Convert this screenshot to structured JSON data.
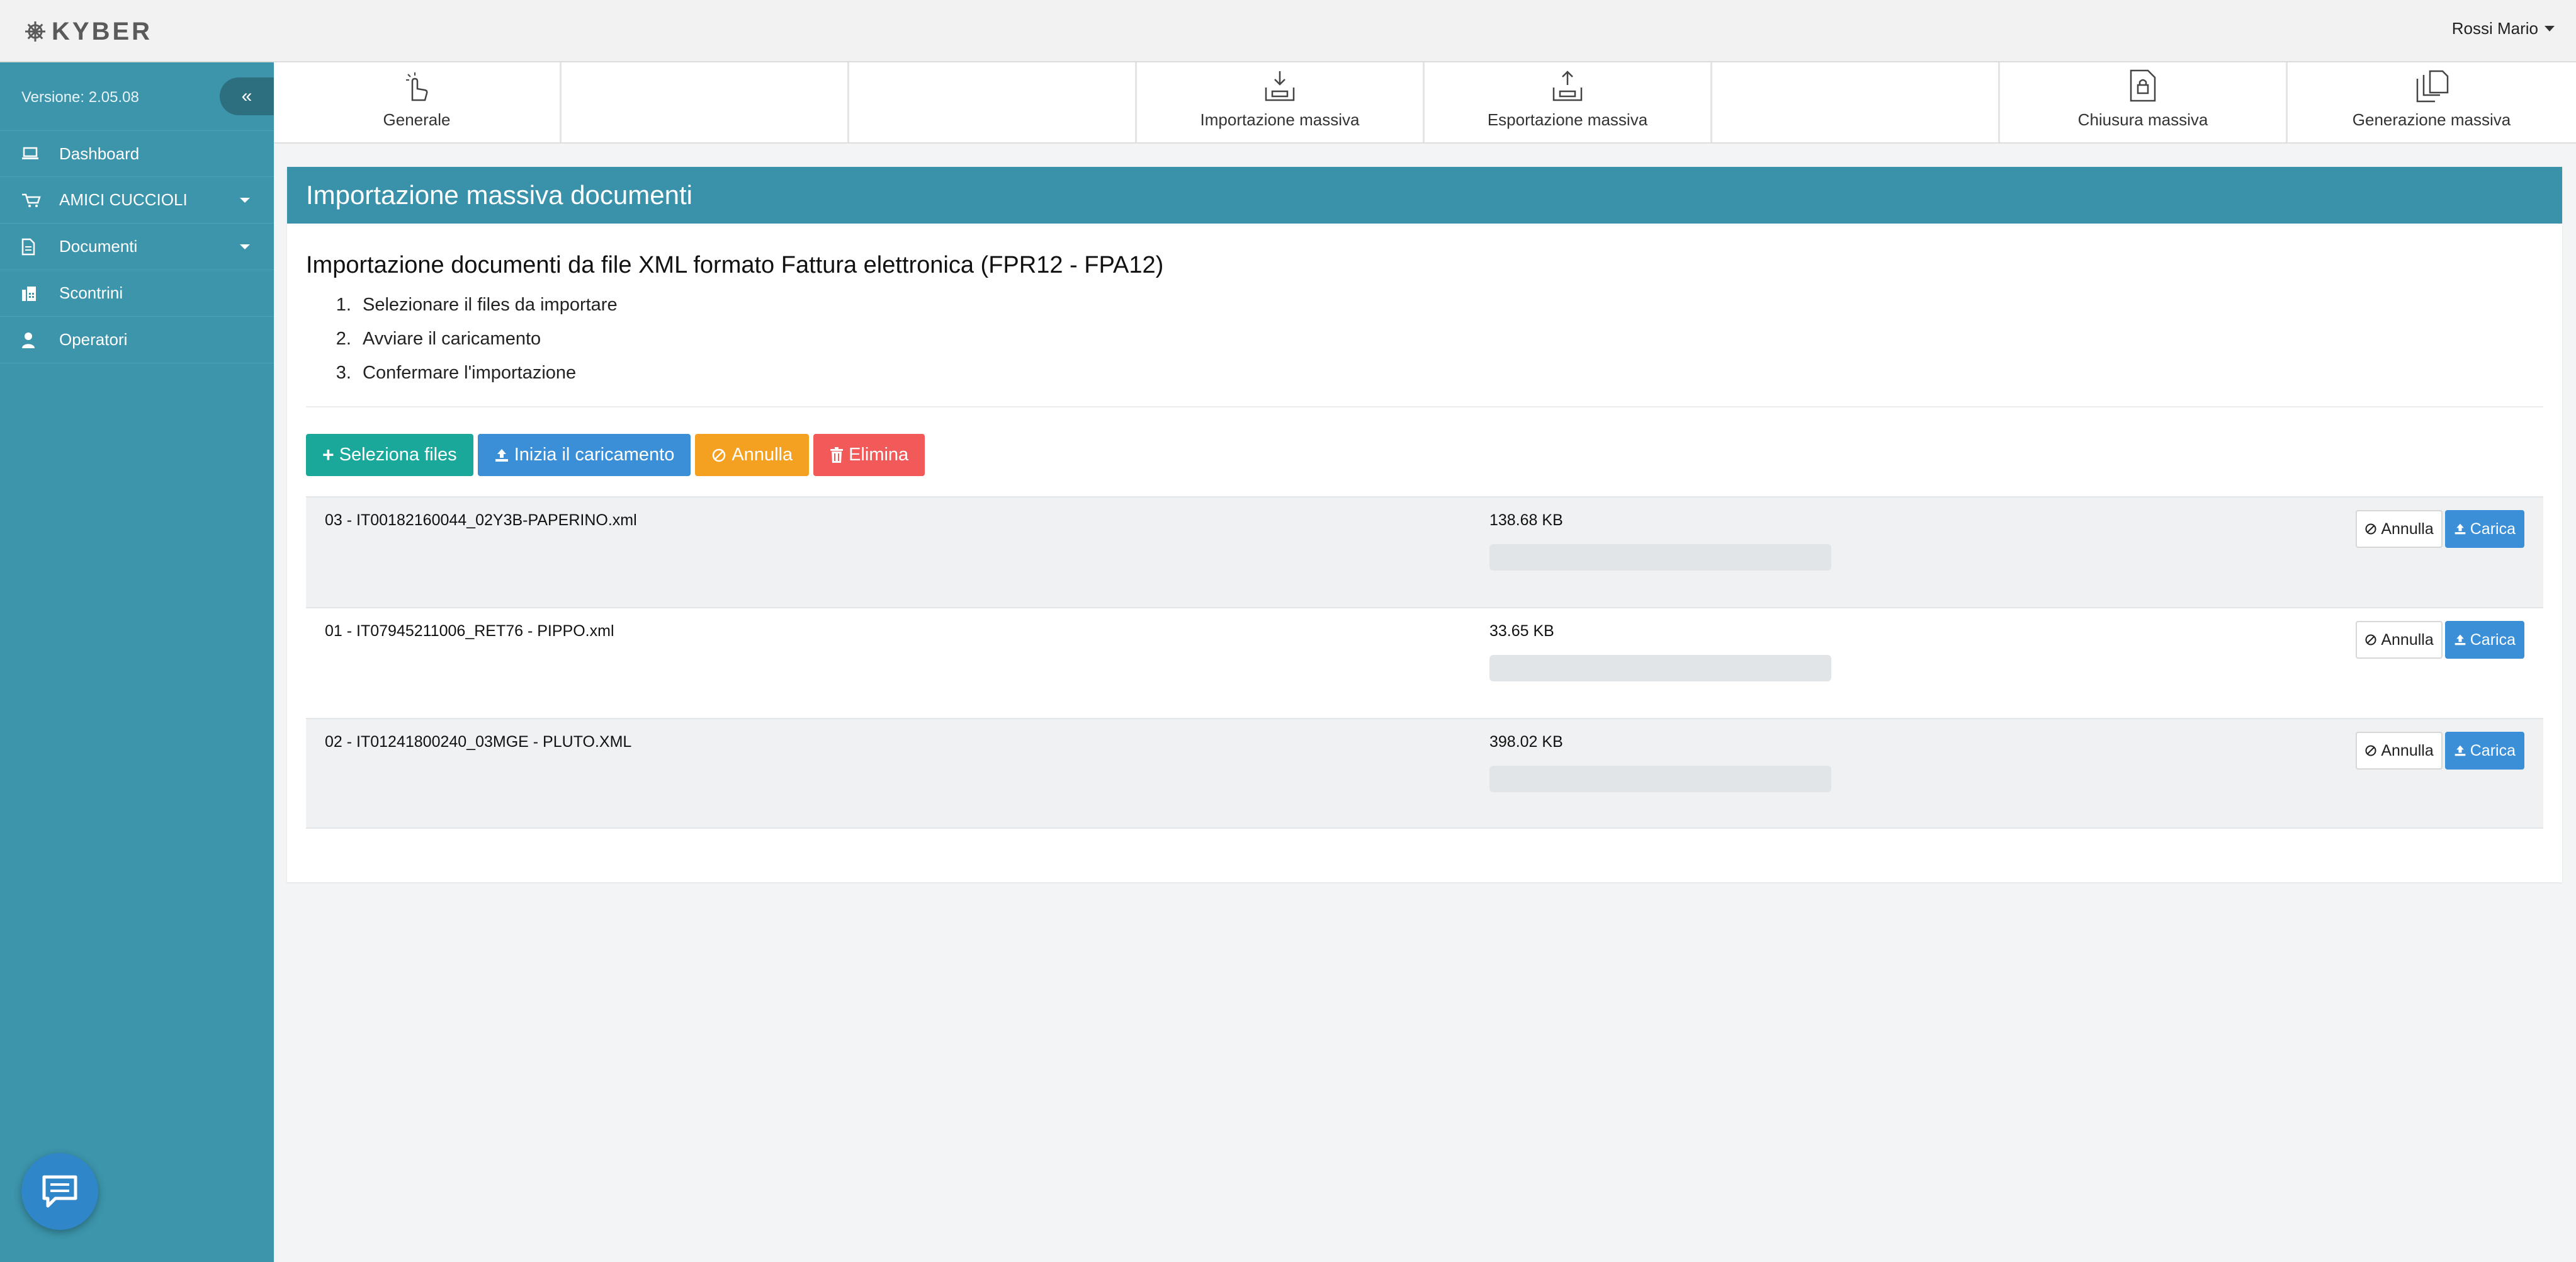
{
  "app": {
    "logo_text": "KYBER",
    "user_name": "Rossi Mario",
    "version": "Versione: 2.05.08"
  },
  "sidebar": {
    "items": [
      {
        "label": "Dashboard",
        "icon": "laptop-icon"
      },
      {
        "label": "AMICI CUCCIOLI",
        "icon": "cart-icon",
        "has_submenu": true
      },
      {
        "label": "Documenti",
        "icon": "document-icon",
        "has_submenu": true
      },
      {
        "label": "Scontrini",
        "icon": "fax-icon"
      },
      {
        "label": "Operatori",
        "icon": "user-icon"
      }
    ]
  },
  "tools": [
    {
      "label": "Generale",
      "icon": "hand-pointer-icon"
    },
    {
      "label": "",
      "icon": ""
    },
    {
      "label": "",
      "icon": ""
    },
    {
      "label": "Importazione massiva",
      "icon": "import-box-icon"
    },
    {
      "label": "Esportazione massiva",
      "icon": "export-box-icon"
    },
    {
      "label": "",
      "icon": ""
    },
    {
      "label": "Chiusura massiva",
      "icon": "lock-document-icon"
    },
    {
      "label": "Generazione massiva",
      "icon": "copy-documents-icon"
    }
  ],
  "panel": {
    "title": "Importazione massiva documenti",
    "subtitle": "Importazione documenti da file XML formato Fattura elettronica (FPR12 - FPA12)",
    "steps": [
      "Selezionare il files da importare",
      "Avviare il caricamento",
      "Confermare l'importazione"
    ]
  },
  "actions": {
    "select": "Seleziona files",
    "start": "Inizia il caricamento",
    "cancel": "Annulla",
    "delete": "Elimina"
  },
  "files": [
    {
      "name": "03 - IT00182160044_02Y3B-PAPERINO.xml",
      "size": "138.68 KB",
      "progress": 0,
      "cancel": "Annulla",
      "upload": "Carica"
    },
    {
      "name": "01 - IT07945211006_RET76 - PIPPO.xml",
      "size": "33.65 KB",
      "progress": 0,
      "cancel": "Annulla",
      "upload": "Carica"
    },
    {
      "name": "02 - IT01241800240_03MGE - PLUTO.XML",
      "size": "398.02 KB",
      "progress": 0,
      "cancel": "Annulla",
      "upload": "Carica"
    }
  ],
  "colors": {
    "sidebar": "#3c95ab",
    "panel_header": "#3a92aa",
    "btn_green": "#1aa89b",
    "btn_blue": "#3a8fd6",
    "btn_orange": "#f4a020",
    "btn_red": "#f25a5a"
  }
}
